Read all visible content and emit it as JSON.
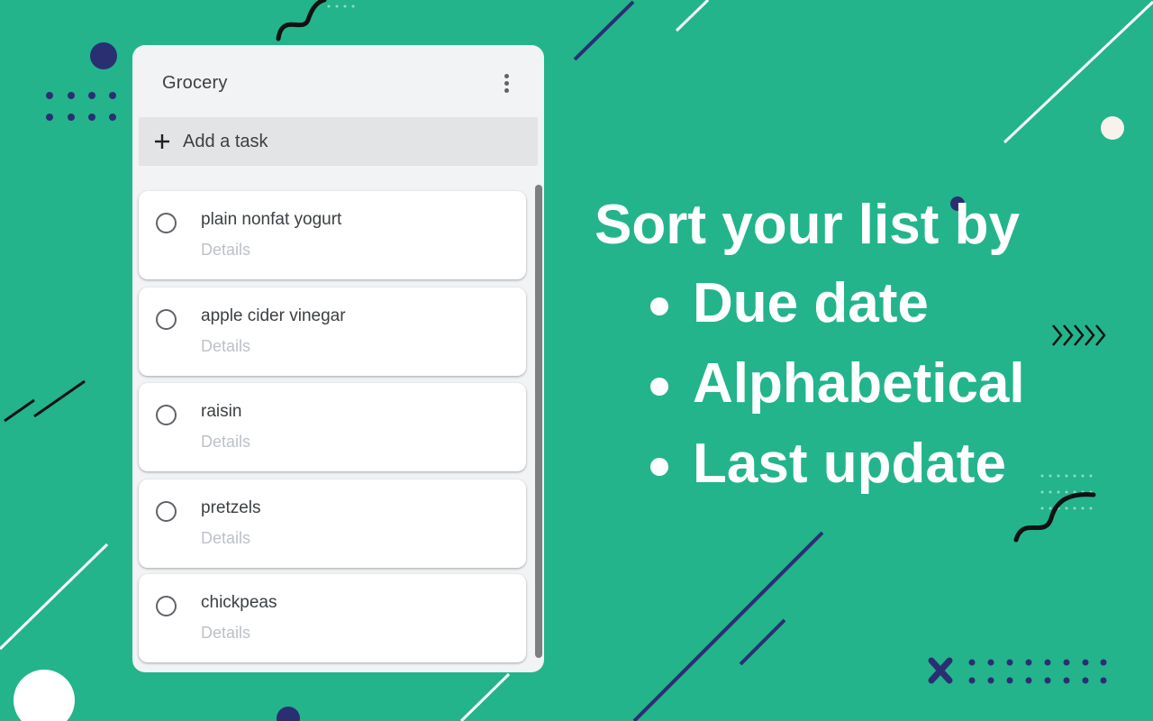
{
  "colors": {
    "background": "#23b48c",
    "panel": "#f1f3f4",
    "accent_navy": "#2a2f72",
    "accent_white": "#ffffff"
  },
  "list": {
    "title": "Grocery",
    "menu_icon": "more-vert-icon"
  },
  "add_task": {
    "icon": "plus-icon",
    "label": "Add a task"
  },
  "tasks": [
    {
      "title": "plain nonfat yogurt",
      "details": "Details"
    },
    {
      "title": "apple cider vinegar",
      "details": "Details"
    },
    {
      "title": "raisin",
      "details": "Details"
    },
    {
      "title": "pretzels",
      "details": "Details"
    },
    {
      "title": "chickpeas",
      "details": "Details"
    }
  ],
  "promo": {
    "headline": "Sort your list by",
    "options": [
      "Due date",
      "Alphabetical",
      "Last update"
    ]
  }
}
